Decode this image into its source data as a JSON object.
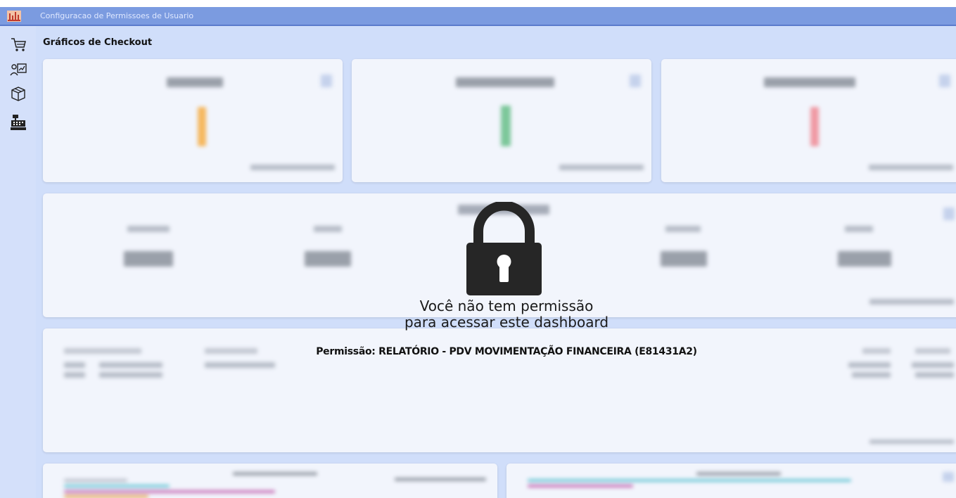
{
  "window": {
    "title": "Configuracao de Permissoes de Usuario"
  },
  "sidebar": {
    "items": [
      {
        "icon": "cart-icon"
      },
      {
        "icon": "sales-chart-icon"
      },
      {
        "icon": "box-icon"
      },
      {
        "icon": "cash-register-icon"
      }
    ]
  },
  "page": {
    "title": "Gráficos de Checkout"
  },
  "lock_overlay": {
    "line1": "Você não tem permissão",
    "line2": "para acessar este dashboard",
    "permission": "Permissão: RELATÓRIO - PDV MOVIMENTAÇÃO FINANCEIRA (E81431A2)"
  },
  "colors": {
    "titlebar": "#7b9be0",
    "background": "#d0defa",
    "card": "#f2f5fc",
    "accent_orange": "#f5b860",
    "accent_green": "#7cc79a",
    "accent_red": "#ef9aa4"
  }
}
